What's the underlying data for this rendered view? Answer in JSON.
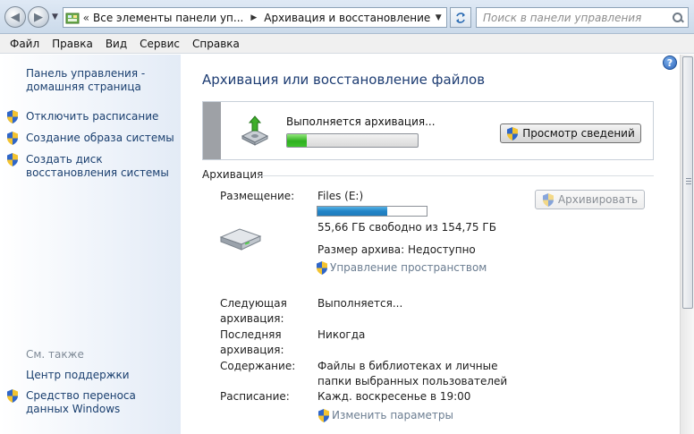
{
  "address": {
    "overflow_chevron": "«",
    "segments": [
      "Все элементы панели уп...",
      "Архивация и восстановление"
    ]
  },
  "search": {
    "placeholder": "Поиск в панели управления"
  },
  "menu": [
    "Файл",
    "Правка",
    "Вид",
    "Сервис",
    "Справка"
  ],
  "sidebar": {
    "home_link": "Панель управления - домашняя страница",
    "tasks": [
      "Отключить расписание",
      "Создание образа системы",
      "Создать диск восстановления системы"
    ],
    "see_also_title": "См. также",
    "see_also": [
      "Центр поддержки",
      "Средство переноса данных Windows"
    ]
  },
  "main": {
    "title": "Архивация или восстановление файлов",
    "status": {
      "text": "Выполняется архивация...",
      "progress_percent": 15,
      "details_button": "Просмотр сведений"
    },
    "backup": {
      "section_title": "Архивация",
      "location_label": "Размещение:",
      "location_value": "Files (E:)",
      "disk_used_fraction": 0.64,
      "free_space": "55,66 ГБ свободно из 154,75 ГБ",
      "archive_size": "Размер архива: Недоступно",
      "manage_space_link": "Управление пространством",
      "backup_button": "Архивировать",
      "next_label": "Следующая архивация:",
      "next_value": "Выполняется...",
      "last_label": "Последняя архивация:",
      "last_value": "Никогда",
      "contents_label": "Содержание:",
      "contents_value": "Файлы в библиотеках и личные папки выбранных пользователей",
      "schedule_label": "Расписание:",
      "schedule_value": "Кажд. воскресенье в 19:00",
      "change_settings_link": "Изменить параметры"
    }
  },
  "help_icon": "?",
  "colors": {
    "link": "#1a3f6f",
    "title": "#1e3d73",
    "progress": "#2fb020",
    "disk_bar": "#2284c7"
  }
}
